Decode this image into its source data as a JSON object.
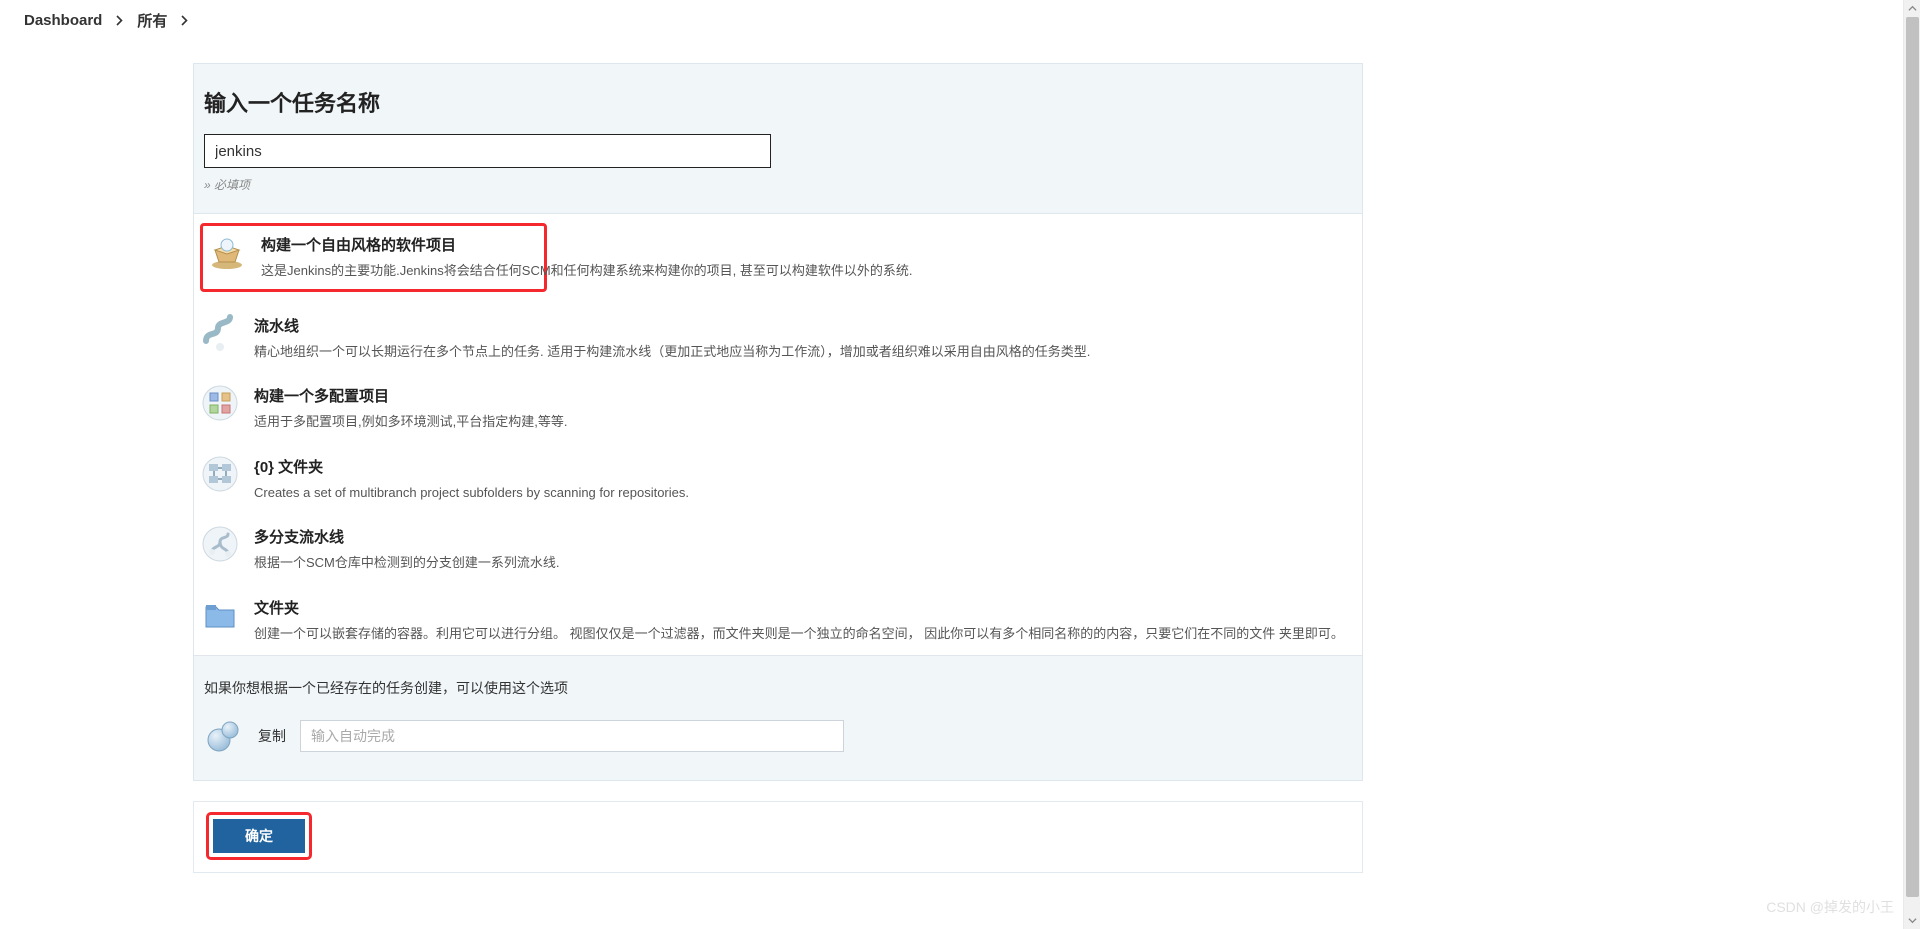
{
  "breadcrumb": {
    "item0": "Dashboard",
    "item1": "所有"
  },
  "panel": {
    "heading": "输入一个任务名称",
    "name_value": "jenkins",
    "required": "» 必填项"
  },
  "types": [
    {
      "title": "构建一个自由风格的软件项目",
      "desc": "这是Jenkins的主要功能.Jenkins将会结合任何SCM和任何构建系统来构建你的项目, 甚至可以构建软件以外的系统."
    },
    {
      "title": "流水线",
      "desc": "精心地组织一个可以长期运行在多个节点上的任务. 适用于构建流水线（更加正式地应当称为工作流），增加或者组织难以采用自由风格的任务类型."
    },
    {
      "title": "构建一个多配置项目",
      "desc": "适用于多配置项目,例如多环境测试,平台指定构建,等等."
    },
    {
      "title": "{0} 文件夹",
      "desc": "Creates a set of multibranch project subfolders by scanning for repositories."
    },
    {
      "title": "多分支流水线",
      "desc": "根据一个SCM仓库中检测到的分支创建一系列流水线."
    },
    {
      "title": "文件夹",
      "desc": "创建一个可以嵌套存储的容器。利用它可以进行分组。 视图仅仅是一个过滤器，而文件夹则是一个独立的命名空间，  因此你可以有多个相同名称的的内容，只要它们在不同的文件 夹里即可。"
    }
  ],
  "copy": {
    "message": "如果你想根据一个已经存在的任务创建，可以使用这个选项",
    "label": "复制",
    "placeholder": "输入自动完成"
  },
  "footer": {
    "ok_label": "确定"
  },
  "watermark": "CSDN @掉发的小王"
}
